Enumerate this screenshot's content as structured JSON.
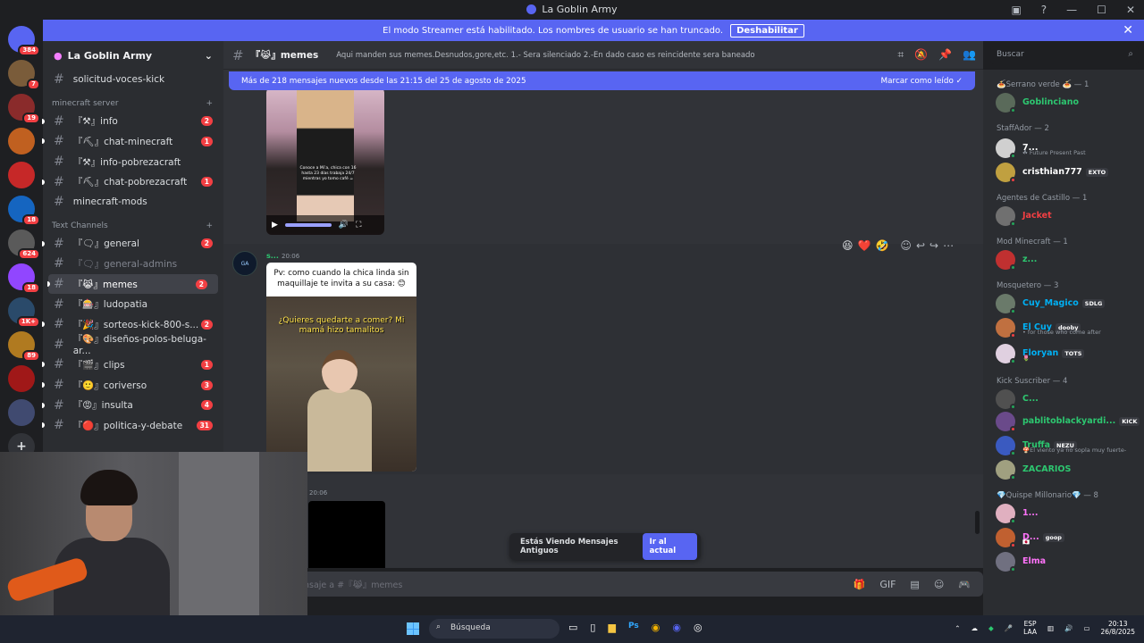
{
  "window": {
    "title": "La Goblin Army"
  },
  "streamer_banner": {
    "text": "El modo Streamer está habilitado. Los nombres de usuario se han truncado.",
    "button": "Deshabilitar"
  },
  "servers": [
    {
      "badge": "384",
      "color": "#5865f2"
    },
    {
      "badge": "7",
      "color": "#7a5c3a"
    },
    {
      "badge": "19",
      "color": "#8a2b2b"
    },
    {
      "badge": "",
      "color": "#c06020"
    },
    {
      "badge": "",
      "color": "#c62828"
    },
    {
      "badge": "18",
      "color": "#1565c0"
    },
    {
      "badge": "624",
      "color": "#5a5a5a"
    },
    {
      "badge": "18",
      "color": "#9146ff"
    },
    {
      "badge": "1K+",
      "color": "#2a4a6a"
    },
    {
      "badge": "89",
      "color": "#b07a20"
    },
    {
      "badge": "",
      "color": "#a01818"
    },
    {
      "badge": "",
      "color": "#404a70"
    }
  ],
  "guild": {
    "name": "La Goblin Army"
  },
  "channels_top": [
    {
      "name": "solicitud-voces-kick",
      "count": ""
    }
  ],
  "cat_minecraft": "minecraft server",
  "channels_minecraft": [
    {
      "name": "『⚒』info",
      "count": "2"
    },
    {
      "name": "『⛏』chat-minecraft",
      "count": "1"
    },
    {
      "name": "『⚒』info-pobrezacraft",
      "count": ""
    },
    {
      "name": "『⛏』chat-pobrezacraft",
      "count": "1"
    },
    {
      "name": "minecraft-mods",
      "count": ""
    }
  ],
  "cat_text": "Text Channels",
  "channels_text": [
    {
      "name": "『🗨』general",
      "count": "2",
      "state": ""
    },
    {
      "name": "『🗨』general-admins",
      "count": "",
      "state": "muted"
    },
    {
      "name": "『😹』memes",
      "count": "2",
      "state": "active"
    },
    {
      "name": "『🎰』ludopatia",
      "count": "",
      "state": ""
    },
    {
      "name": "『🎉』sorteos-kick-800-s...",
      "count": "2",
      "state": ""
    },
    {
      "name": "『🎨』diseños-polos-beluga-ar...",
      "count": "",
      "state": ""
    },
    {
      "name": "『🎬』clips",
      "count": "1",
      "state": ""
    },
    {
      "name": "『🙂』coriverso",
      "count": "3",
      "state": ""
    },
    {
      "name": "『😡』insulta",
      "count": "4",
      "state": ""
    },
    {
      "name": "『🔴』politica-y-debate",
      "count": "31",
      "state": ""
    }
  ],
  "topbar": {
    "channel": "『😹』memes",
    "topic": "Aqui manden sus memes.Desnudos,gore,etc. 1.- Sera silenciado 2.-En dado caso es reincidente sera baneado"
  },
  "search": {
    "placeholder": "Buscar"
  },
  "new_messages": {
    "text": "Más de 218 mensajes nuevos desde las 21:15 del 25 de agosto de 2025",
    "action": "Marcar como leído"
  },
  "video_caption": "Conoce a Mi’a, chica con 16 hasta 23 días trabaja 24/7 mientras yo tomo café ☕",
  "message": {
    "author": "s...",
    "time": "20:06",
    "text": "Pv: como cuando la chica linda sin maquillaje te invita a su casa: 😊",
    "image_caption": "¿Quieres quedarte a comer? Mi mamá hizo tamalitos"
  },
  "reactions": [
    "😆",
    "❤️",
    "🤣"
  ],
  "message2": {
    "time": "20:06"
  },
  "old_messages": {
    "text": "Estás Viendo Mensajes Antiguos",
    "button": "Ir al actual"
  },
  "composer": {
    "placeholder": "nsaje a #『😹』memes"
  },
  "members": [
    {
      "role": "🍝Serrano verde 🍝 — 1",
      "items": [
        {
          "name": "Goblinciano",
          "color": "#2dc770",
          "tag": "",
          "sub": "",
          "av": "#5a6a5a"
        }
      ]
    },
    {
      "role": "StaffAdor — 2",
      "items": [
        {
          "name": "7...",
          "color": "#ffffff",
          "tag": "",
          "sub": "☘ Future Present Past",
          "av": "#d0d0d0"
        },
        {
          "name": "cristhian777",
          "color": "#ffffff",
          "tag": "EXTO",
          "sub": "",
          "av": "#c0a040"
        }
      ]
    },
    {
      "role": "Agentes de Castillo — 1",
      "items": [
        {
          "name": "Jacket",
          "color": "#f23f43",
          "tag": "",
          "sub": "",
          "av": "#707070"
        }
      ]
    },
    {
      "role": "Mod Minecraft — 1",
      "items": [
        {
          "name": "z...",
          "color": "#2dc770",
          "tag": "",
          "sub": "",
          "av": "#c03030"
        }
      ]
    },
    {
      "role": "Mosquetero — 3",
      "items": [
        {
          "name": "Cuy_Magico",
          "color": "#00b0f4",
          "tag": "SDLG",
          "sub": "",
          "av": "#6a7a6a"
        },
        {
          "name": "El Cuy",
          "color": "#00b0f4",
          "tag": "dooby",
          "sub": "• for those who come after",
          "av": "#c07040"
        },
        {
          "name": "Floryan",
          "color": "#00b0f4",
          "tag": "TOTS",
          "sub": "🌷",
          "av": "#e0d0e0"
        }
      ]
    },
    {
      "role": "Kick Suscriber — 4",
      "items": [
        {
          "name": "C...",
          "color": "#2dc770",
          "tag": "",
          "sub": "",
          "av": "#505050"
        },
        {
          "name": "pablitoblackyardi...",
          "color": "#2dc770",
          "tag": "KICK",
          "sub": "",
          "av": "#6a4a8a"
        },
        {
          "name": "Truffa",
          "color": "#2dc770",
          "tag": "NEZU",
          "sub": "🍄El viento ya no sopla muy fuerte-",
          "av": "#3a5ac0"
        },
        {
          "name": "ZACARIOS",
          "color": "#2dc770",
          "tag": "",
          "sub": "",
          "av": "#a0a080"
        }
      ]
    },
    {
      "role": "💎Quispe Millonario💎 — 8",
      "items": [
        {
          "name": "1...",
          "color": "#ff73fa",
          "tag": "",
          "sub": "",
          "av": "#e0b0c0"
        },
        {
          "name": "D...",
          "color": "#ff73fa",
          "tag": "goop",
          "sub": "🇯🇵",
          "av": "#c06030"
        },
        {
          "name": "Elma",
          "color": "#ff73fa",
          "tag": "",
          "sub": "",
          "av": "#707080"
        }
      ]
    }
  ],
  "taskbar": {
    "search": "Búsqueda",
    "lang": "ESP",
    "lang2": "LAA",
    "time": "20:13",
    "date": "26/8/2025"
  }
}
